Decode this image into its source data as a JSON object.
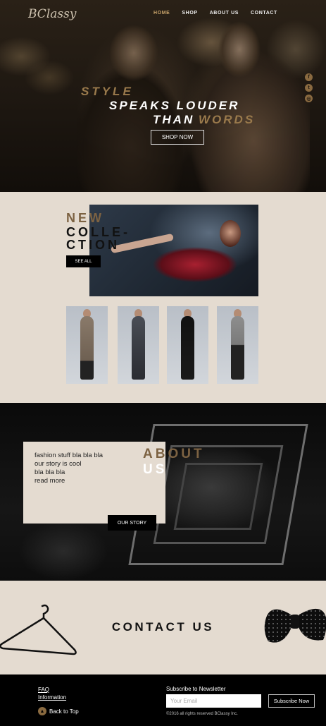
{
  "brand": {
    "logo": "BClassy"
  },
  "nav": {
    "items": [
      {
        "label": "HOME",
        "active": true
      },
      {
        "label": "SHOP",
        "active": false
      },
      {
        "label": "ABOUT US",
        "active": false
      },
      {
        "label": "CONTACT",
        "active": false
      }
    ]
  },
  "social": [
    {
      "icon": "facebook-icon",
      "glyph": "f"
    },
    {
      "icon": "twitter-icon",
      "glyph": "t"
    },
    {
      "icon": "instagram-icon",
      "glyph": "◎"
    }
  ],
  "hero": {
    "line1": "STYLE",
    "line2": "SPEAKS LOUDER",
    "line3_a": "THAN",
    "line3_b": "WORDS",
    "cta": "SHOP NOW"
  },
  "collection": {
    "title_1": "NEW",
    "title_2": "COLLE-",
    "title_3": "CTION",
    "see_all": "SEE ALL"
  },
  "about": {
    "lines": [
      "fashion stuff bla bla bla",
      "our story is cool",
      "bla bla bla",
      "read more"
    ],
    "title_1": "ABOUT",
    "title_2": "US",
    "cta": "OUR STORY"
  },
  "contact": {
    "title": "CONTACT US"
  },
  "footer": {
    "faq": "FAQ",
    "information": "Information",
    "back_to_top": "Back to Top",
    "newsletter_label": "Subscribe to Newsletter",
    "email_placeholder": "Your Email",
    "subscribe": "Subscribe Now",
    "copyright": "©2016 all rights reserved BClassy Inc."
  },
  "colors": {
    "accent": "#7c6242",
    "sand": "#e4dbd0",
    "dark": "#000000"
  }
}
